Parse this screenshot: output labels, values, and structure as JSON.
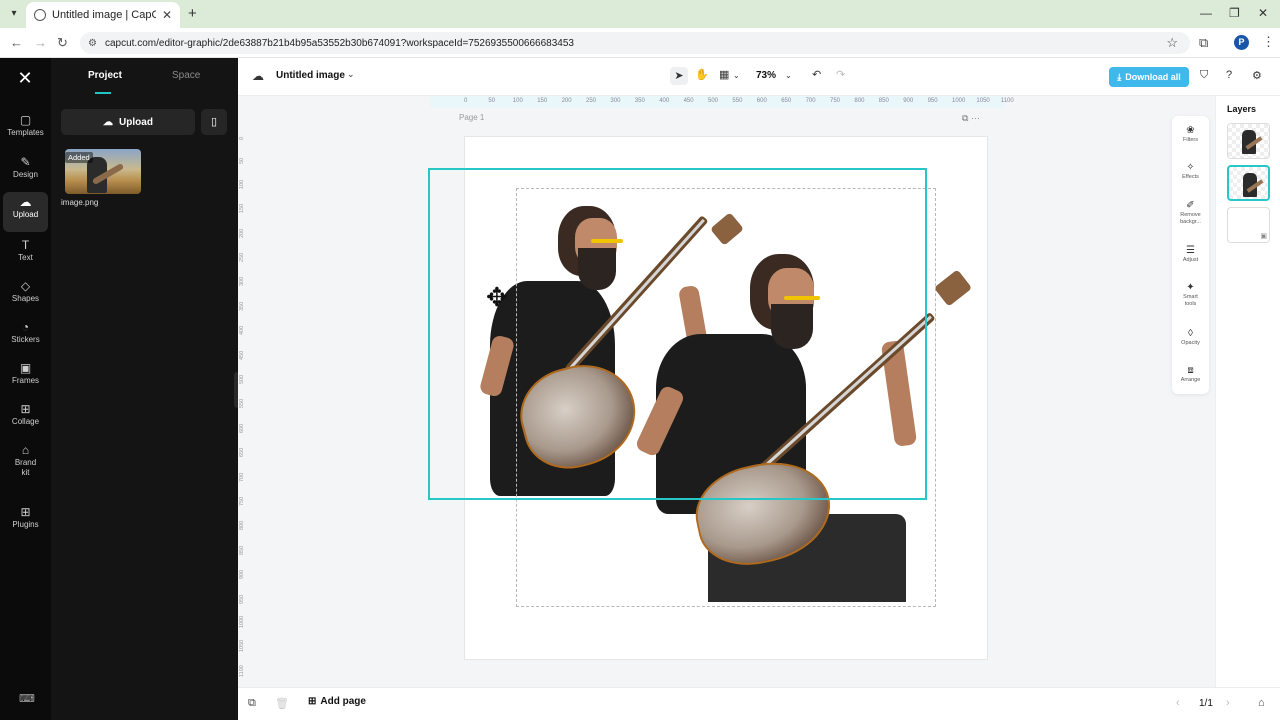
{
  "browser": {
    "tab_title": "Untitled image | CapCut",
    "url": "capcut.com/editor-graphic/2de63887b21b4b95a53552b30b674091?workspaceId=7526935500666683453",
    "profile_initial": "P"
  },
  "rail": {
    "items": [
      {
        "label": "Templates",
        "icon": "templates-icon"
      },
      {
        "label": "Design",
        "icon": "design-icon"
      },
      {
        "label": "Upload",
        "icon": "upload-icon"
      },
      {
        "label": "Text",
        "icon": "text-icon"
      },
      {
        "label": "Shapes",
        "icon": "shapes-icon"
      },
      {
        "label": "Stickers",
        "icon": "stickers-icon"
      },
      {
        "label": "Frames",
        "icon": "frames-icon"
      },
      {
        "label": "Collage",
        "icon": "collage-icon"
      },
      {
        "label": "Brand\nkit",
        "icon": "brand-kit-icon"
      },
      {
        "label": "Plugins",
        "icon": "plugins-icon"
      }
    ],
    "active": "Upload"
  },
  "panel": {
    "tabs": [
      "Project",
      "Space"
    ],
    "upload_label": "Upload",
    "asset": {
      "badge": "Added",
      "name": "image.png"
    }
  },
  "toolbar": {
    "doc_title": "Untitled image",
    "zoom": "73%",
    "download_label": "Download all"
  },
  "canvas": {
    "page_label": "Page 1",
    "ruler_top": [
      "0",
      "50",
      "100",
      "150",
      "200",
      "250",
      "300",
      "350",
      "400",
      "450",
      "500",
      "550",
      "600",
      "650",
      "700",
      "750",
      "800",
      "850",
      "900",
      "950",
      "1000",
      "1050",
      "1100"
    ],
    "ruler_left": [
      "0",
      "50",
      "100",
      "150",
      "200",
      "250",
      "300",
      "350",
      "400",
      "450",
      "500",
      "550",
      "600",
      "650",
      "700",
      "750",
      "800",
      "850",
      "900",
      "950",
      "1000",
      "1050",
      "1100"
    ]
  },
  "properties": [
    {
      "label": "Filters",
      "icon": "filters-icon"
    },
    {
      "label": "Effects",
      "icon": "effects-icon"
    },
    {
      "label": "Remove backgr...",
      "icon": "remove-background-icon"
    },
    {
      "label": "Adjust",
      "icon": "adjust-icon"
    },
    {
      "label": "Smart tools",
      "icon": "smart-tools-icon"
    },
    {
      "label": "Opacity",
      "icon": "opacity-icon"
    },
    {
      "label": "Arrange",
      "icon": "arrange-icon"
    }
  ],
  "layers": {
    "title": "Layers"
  },
  "bottom": {
    "add_page": "Add page",
    "page_count": "1/1"
  },
  "colors": {
    "accent": "#28c7c7",
    "download": "#3fb8ec"
  }
}
